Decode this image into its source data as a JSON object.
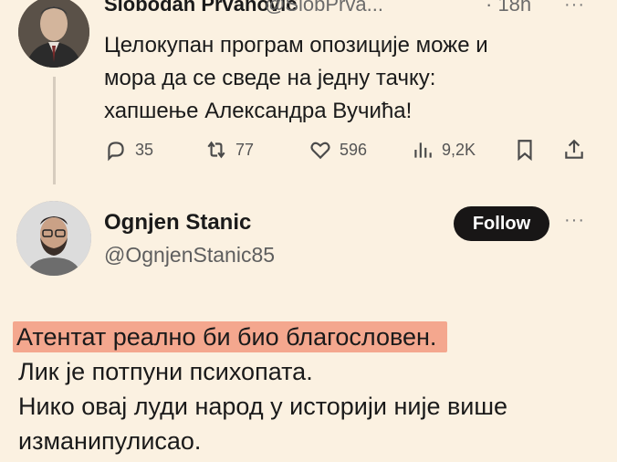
{
  "tweet1": {
    "author_name": "Slobodan Prvanović",
    "handle": "@SlobPrva...",
    "time": "· 18h",
    "more": "···",
    "lines": [
      "Целокупан програм опозиције може и",
      "мора да се сведе на једну тачку:",
      "хапшење Александра Вучића!"
    ],
    "actions": {
      "replies": "35",
      "reposts": "77",
      "likes": "596",
      "views": "9,2K"
    }
  },
  "tweet2": {
    "author_name": "Ognjen Stanic",
    "handle": "@OgnjenStanic85",
    "follow_label": "Follow",
    "more": "···",
    "highlighted_line": "Атентат реално би био благословен.",
    "lines": [
      "Лик је потпуни психопата.",
      "Нико овај луди народ у историји није више",
      "изманипулисао."
    ]
  },
  "colors": {
    "background": "#fbf1e1",
    "highlight": "#f4a78e",
    "follow_button": "#181616"
  }
}
